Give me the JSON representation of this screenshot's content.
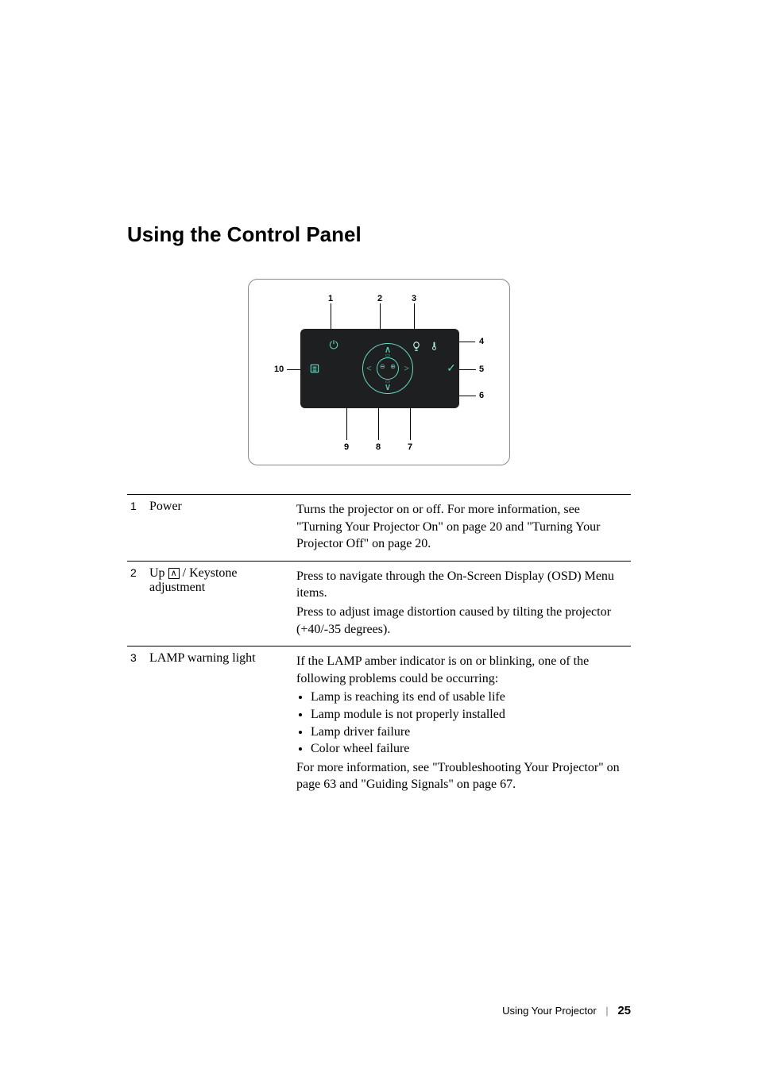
{
  "title": "Using the Control Panel",
  "diagram": {
    "callouts": [
      "1",
      "2",
      "3",
      "4",
      "5",
      "6",
      "7",
      "8",
      "9",
      "10"
    ]
  },
  "rows": [
    {
      "n": "1",
      "label_html": "Power",
      "desc_html": "<p>Turns the projector on or off. For more information, see \"Turning Your Projector On\" on page 20 and \"Turning Your Projector Off\" on page 20.</p>"
    },
    {
      "n": "2",
      "label_html": "Up <span class='upglyph'>∧</span> / Keystone adjustment",
      "desc_html": "<p>Press to navigate through the On-Screen Display (OSD) Menu items.</p><p>Press to adjust image distortion caused by tilting the projector (+40/-35 degrees).</p>"
    },
    {
      "n": "3",
      "label_html": "LAMP warning light",
      "desc_html": "<p>If the LAMP amber indicator is on or blinking, one of the following problems could be occurring:</p><ul><li>Lamp is reaching its end of usable life</li><li>Lamp module is not properly installed</li><li>Lamp driver failure</li><li>Color wheel failure</li></ul><p>For more information, see \"Troubleshooting Your Projector\" on page 63 and \"Guiding Signals\" on page 67.</p>"
    }
  ],
  "footer": {
    "section": "Using Your Projector",
    "page": "25"
  }
}
